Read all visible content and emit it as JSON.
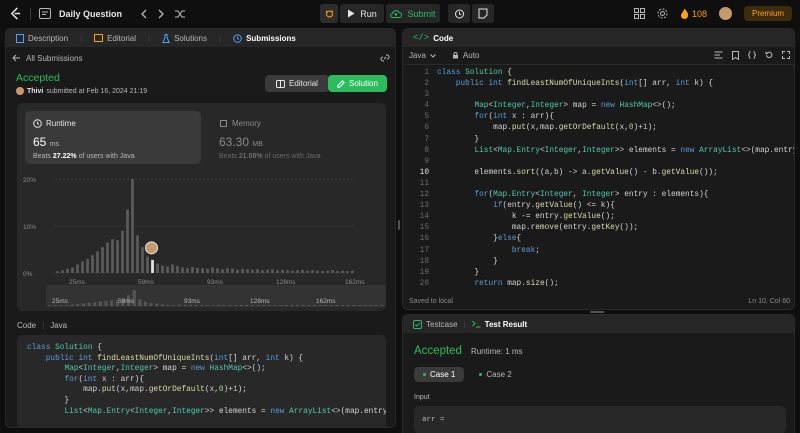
{
  "topbar": {
    "title": "Daily Question",
    "run_label": "Run",
    "submit_label": "Submit",
    "streak_count": "108",
    "premium_label": "Premium"
  },
  "left_tabs": [
    "Description",
    "Editorial",
    "Solutions",
    "Submissions"
  ],
  "submission": {
    "back_label": "All Submissions",
    "status": "Accepted",
    "user": "Thivi",
    "submitted_text": "submitted at Feb 16, 2024 21:19",
    "editorial_button": "Editorial",
    "solution_button": "Solution",
    "runtime_label": "Runtime",
    "runtime_value": "65",
    "runtime_unit": "ms",
    "runtime_beats_pct": "27.22%",
    "beats_prefix": "Beats",
    "runtime_beats_suffix": "of users with Java",
    "memory_label": "Memory",
    "memory_value": "63.30",
    "memory_unit": "MB",
    "memory_beats_pct": "21.66%",
    "memory_beats_suffix": "of users with Java",
    "code_label": "Code",
    "lang_label": "Java"
  },
  "chart_data": {
    "type": "bar",
    "y_ticks": [
      "20%",
      "10%",
      "0%"
    ],
    "ylim": [
      0,
      20
    ],
    "x_tick_labels": [
      "25ms",
      "59ms",
      "93ms",
      "128ms",
      "162ms"
    ],
    "values": [
      0.4,
      0.6,
      0.9,
      1.2,
      1.8,
      2.5,
      3.0,
      3.8,
      4.6,
      5.5,
      6.5,
      7.2,
      7.0,
      9.0,
      13.5,
      20.0,
      8.0,
      5.5,
      3.5,
      2.8,
      2.0,
      1.6,
      1.4,
      1.8,
      1.5,
      1.2,
      1.0,
      1.3,
      1.1,
      1.0,
      0.9,
      1.2,
      1.0,
      0.8,
      1.0,
      0.9,
      0.7,
      0.9,
      0.8,
      0.7,
      0.8,
      0.6,
      0.7,
      0.8,
      0.6,
      0.7,
      0.6,
      0.5,
      0.6,
      0.7,
      0.5,
      0.6,
      0.5,
      0.4,
      0.5,
      0.6,
      0.4,
      0.5,
      0.4,
      0.5
    ],
    "highlight_index": 19,
    "mini_x_tick_labels": [
      "25ms",
      "59ms",
      "93ms",
      "128ms",
      "162ms"
    ]
  },
  "left_code": [
    [
      [
        "kw",
        "class "
      ],
      [
        "ty",
        "Solution "
      ],
      [
        "pl",
        "{"
      ]
    ],
    [
      [
        "pl",
        "    "
      ],
      [
        "kw",
        "public int "
      ],
      [
        "fn",
        "findLeastNumOfUniqueInts"
      ],
      [
        "pl",
        "("
      ],
      [
        "kw",
        "int"
      ],
      [
        "pl",
        "[] arr, "
      ],
      [
        "kw",
        "int "
      ],
      [
        "pl",
        "k) {"
      ]
    ],
    [
      [
        "pl",
        ""
      ]
    ],
    [
      [
        "pl",
        "        "
      ],
      [
        "ty",
        "Map"
      ],
      [
        "pl",
        "<"
      ],
      [
        "ty",
        "Integer"
      ],
      [
        "pl",
        ","
      ],
      [
        "ty",
        "Integer"
      ],
      [
        "pl",
        "> map = "
      ],
      [
        "kw",
        "new "
      ],
      [
        "ty",
        "HashMap"
      ],
      [
        "pl",
        "<>();"
      ]
    ],
    [
      [
        "pl",
        "        "
      ],
      [
        "kw",
        "for"
      ],
      [
        "pl",
        "("
      ],
      [
        "kw",
        "int "
      ],
      [
        "pl",
        "x : arr){"
      ]
    ],
    [
      [
        "pl",
        "            map."
      ],
      [
        "fn",
        "put"
      ],
      [
        "pl",
        "(x,map."
      ],
      [
        "fn",
        "getOrDefault"
      ],
      [
        "pl",
        "(x,"
      ],
      [
        "nm",
        "0"
      ],
      [
        "pl",
        ")+"
      ],
      [
        "nm",
        "1"
      ],
      [
        "pl",
        ");"
      ]
    ],
    [
      [
        "pl",
        "        }"
      ]
    ],
    [
      [
        "pl",
        "        "
      ],
      [
        "ty",
        "List"
      ],
      [
        "pl",
        "<"
      ],
      [
        "ty",
        "Map.Entry"
      ],
      [
        "pl",
        "<"
      ],
      [
        "ty",
        "Integer"
      ],
      [
        "pl",
        ","
      ],
      [
        "ty",
        "Integer"
      ],
      [
        "pl",
        ">> elements = "
      ],
      [
        "kw",
        "new "
      ],
      [
        "ty",
        "ArrayList"
      ],
      [
        "pl",
        "<>(map.entrySet("
      ]
    ]
  ],
  "code_panel": {
    "title": "Code",
    "lang": "Java",
    "mode": "Auto",
    "footer_left": "Saved to local",
    "footer_right": "Ln 10, Col 60",
    "lines": [
      [
        [
          "kw",
          "class "
        ],
        [
          "ty",
          "Solution "
        ],
        [
          "pl",
          "{"
        ]
      ],
      [
        [
          "pl",
          "    "
        ],
        [
          "kw",
          "public int "
        ],
        [
          "fn",
          "findLeastNumOfUniqueInts"
        ],
        [
          "pl",
          "("
        ],
        [
          "kw",
          "int"
        ],
        [
          "pl",
          "[] arr, "
        ],
        [
          "kw",
          "int "
        ],
        [
          "pl",
          "k) {"
        ]
      ],
      [
        [
          "pl",
          ""
        ]
      ],
      [
        [
          "pl",
          "        "
        ],
        [
          "ty",
          "Map"
        ],
        [
          "pl",
          "<"
        ],
        [
          "ty",
          "Integer"
        ],
        [
          "pl",
          ","
        ],
        [
          "ty",
          "Integer"
        ],
        [
          "pl",
          "> map = "
        ],
        [
          "kw",
          "new "
        ],
        [
          "ty",
          "HashMap"
        ],
        [
          "pl",
          "<>();"
        ]
      ],
      [
        [
          "pl",
          "        "
        ],
        [
          "kw",
          "for"
        ],
        [
          "pl",
          "("
        ],
        [
          "kw",
          "int "
        ],
        [
          "pl",
          "x : arr){"
        ]
      ],
      [
        [
          "pl",
          "            map."
        ],
        [
          "fn",
          "put"
        ],
        [
          "pl",
          "(x,map."
        ],
        [
          "fn",
          "getOrDefault"
        ],
        [
          "pl",
          "(x,"
        ],
        [
          "nm",
          "0"
        ],
        [
          "pl",
          ")+"
        ],
        [
          "nm",
          "1"
        ],
        [
          "pl",
          ");"
        ]
      ],
      [
        [
          "pl",
          "        }"
        ]
      ],
      [
        [
          "pl",
          "        "
        ],
        [
          "ty",
          "List"
        ],
        [
          "pl",
          "<"
        ],
        [
          "ty",
          "Map.Entry"
        ],
        [
          "pl",
          "<"
        ],
        [
          "ty",
          "Integer"
        ],
        [
          "pl",
          ","
        ],
        [
          "ty",
          "Integer"
        ],
        [
          "pl",
          ">> elements = "
        ],
        [
          "kw",
          "new "
        ],
        [
          "ty",
          "ArrayList"
        ],
        [
          "pl",
          "<>(map.entrySet());"
        ]
      ],
      [
        [
          "pl",
          ""
        ]
      ],
      [
        [
          "pl",
          "        elements."
        ],
        [
          "fn",
          "sort"
        ],
        [
          "pl",
          "((a,b) -> a."
        ],
        [
          "fn",
          "getValue"
        ],
        [
          "pl",
          "() - b."
        ],
        [
          "fn",
          "getValue"
        ],
        [
          "pl",
          "());"
        ]
      ],
      [
        [
          "pl",
          ""
        ]
      ],
      [
        [
          "pl",
          "        "
        ],
        [
          "kw",
          "for"
        ],
        [
          "pl",
          "("
        ],
        [
          "ty",
          "Map.Entry"
        ],
        [
          "pl",
          "<"
        ],
        [
          "ty",
          "Integer"
        ],
        [
          "pl",
          ", "
        ],
        [
          "ty",
          "Integer"
        ],
        [
          "pl",
          "> entry : elements){"
        ]
      ],
      [
        [
          "pl",
          "            "
        ],
        [
          "kw",
          "if"
        ],
        [
          "pl",
          "(entry."
        ],
        [
          "fn",
          "getValue"
        ],
        [
          "pl",
          "() <= k){"
        ]
      ],
      [
        [
          "pl",
          "                k -= entry."
        ],
        [
          "fn",
          "getValue"
        ],
        [
          "pl",
          "();"
        ]
      ],
      [
        [
          "pl",
          "                map."
        ],
        [
          "fn",
          "remove"
        ],
        [
          "pl",
          "(entry."
        ],
        [
          "fn",
          "getKey"
        ],
        [
          "pl",
          "());"
        ]
      ],
      [
        [
          "pl",
          "            }"
        ],
        [
          "kw",
          "else"
        ],
        [
          "pl",
          "{"
        ]
      ],
      [
        [
          "pl",
          "                "
        ],
        [
          "kw",
          "break"
        ],
        [
          "pl",
          ";"
        ]
      ],
      [
        [
          "pl",
          "            }"
        ]
      ],
      [
        [
          "pl",
          "        }"
        ]
      ],
      [
        [
          "pl",
          "        "
        ],
        [
          "kw",
          "return "
        ],
        [
          "pl",
          "map."
        ],
        [
          "fn",
          "size"
        ],
        [
          "pl",
          "();"
        ]
      ]
    ]
  },
  "test_panel": {
    "tab_testcase": "Testcase",
    "tab_result": "Test Result",
    "status": "Accepted",
    "runtime_text": "Runtime: 1 ms",
    "case1": "Case 1",
    "case2": "Case 2",
    "input_label": "Input",
    "input_value": "arr ="
  }
}
